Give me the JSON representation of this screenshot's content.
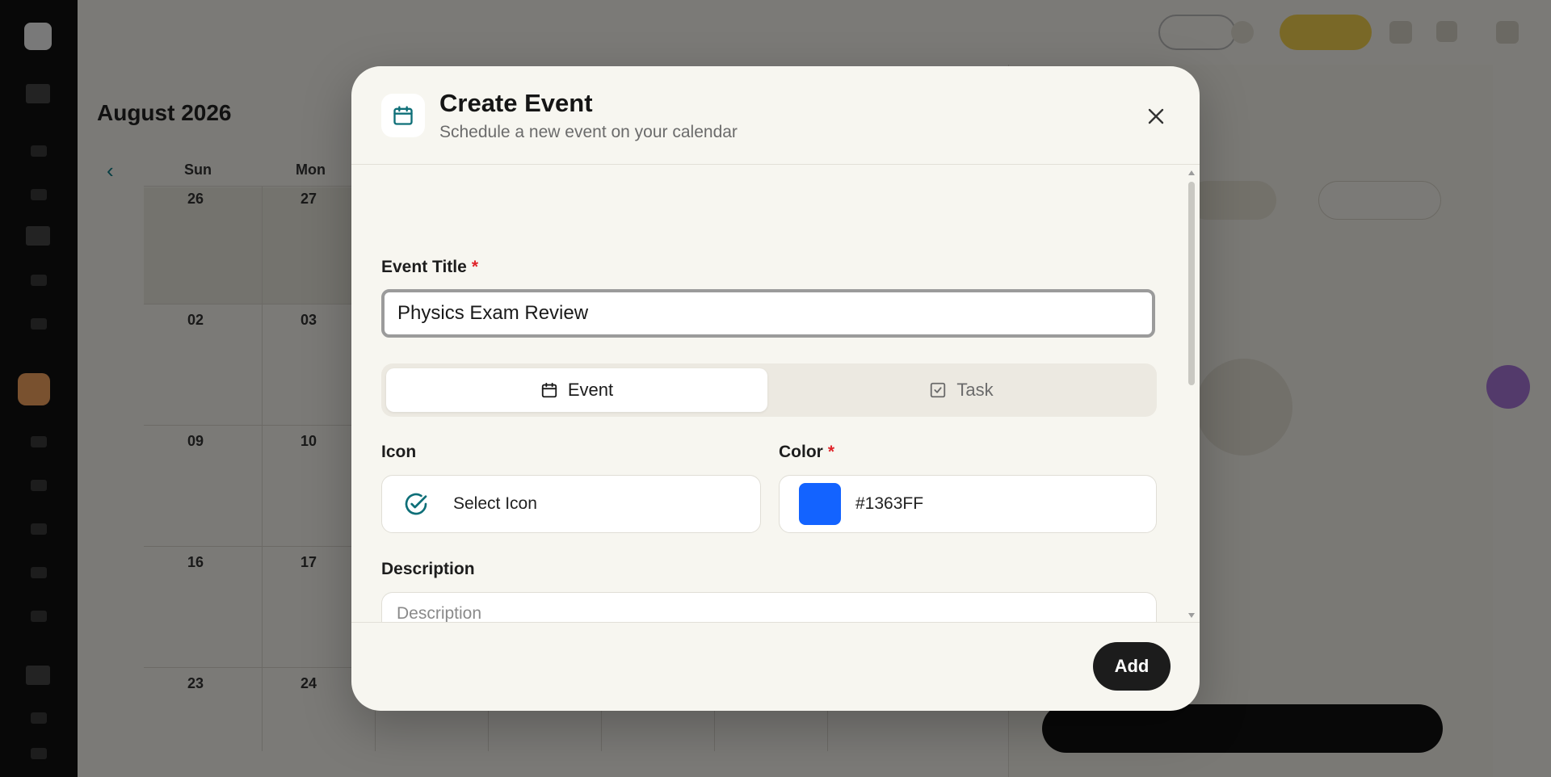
{
  "background": {
    "calendar_title": "August 2026",
    "weekdays": [
      "Sun",
      "Mon"
    ],
    "day_numbers": [
      "26",
      "27",
      "02",
      "03",
      "09",
      "10",
      "16",
      "17",
      "23",
      "24"
    ]
  },
  "modal": {
    "title": "Create Event",
    "subtitle": "Schedule a new event on your calendar",
    "header_icon": "calendar-icon",
    "close_icon": "close-icon",
    "event_title": {
      "label": "Event Title",
      "required_mark": "*",
      "value": "Physics Exam Review"
    },
    "type_toggle": {
      "event_label": "Event",
      "task_label": "Task",
      "selected": "Event"
    },
    "icon_field": {
      "label": "Icon",
      "value": "Select Icon",
      "icon": "check-circle-icon"
    },
    "color_field": {
      "label": "Color",
      "required_mark": "*",
      "value": "#1363FF"
    },
    "description": {
      "label": "Description",
      "placeholder": "Description"
    },
    "submit_label": "Add"
  },
  "colors": {
    "accent": "#1363FF",
    "teal_icon": "#0e6f78",
    "required": "#e0242a",
    "primary_button": "#1c1c1c"
  }
}
